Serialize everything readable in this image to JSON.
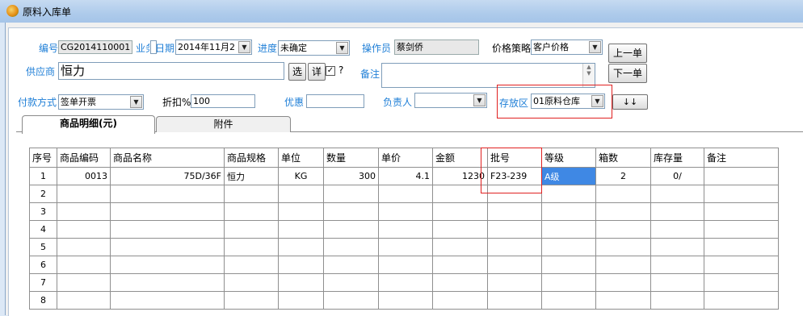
{
  "window": {
    "title": "原料入库单"
  },
  "header": {
    "code_label": "编号",
    "code_value": "CG2014110001",
    "biz_label_partial": "业务",
    "date_label_partial": "日期",
    "date_value": "2014年11月2",
    "progress_label": "进度",
    "progress_value": "未确定",
    "operator_label": "操作员",
    "operator_value": "蔡剑侨",
    "price_policy_label": "价格策略",
    "price_policy_value": "客户价格",
    "prev_button": "上一单",
    "next_button": "下一单",
    "supplier_label": "供应商",
    "supplier_value": "恒力",
    "select_button": "选",
    "detail_button": "详",
    "question": "?",
    "remark_label": "备注",
    "remark_value": "",
    "payment_label": "付款方式",
    "payment_value": "签单开票",
    "discount_label": "折扣%",
    "discount_value": "100",
    "preferential_label": "优惠",
    "preferential_value": "",
    "manager_label": "负责人",
    "manager_value": "",
    "storage_label": "存放区",
    "storage_value": "01原料仓库",
    "arrows_button": "↓↓"
  },
  "tabs": [
    {
      "label": "商品明细(元)",
      "active": true
    },
    {
      "label": "附件",
      "active": false
    }
  ],
  "table": {
    "columns": [
      "序号",
      "商品编码",
      "商品名称",
      "商品规格",
      "单位",
      "数量",
      "单价",
      "金额",
      "批号",
      "等级",
      "箱数",
      "库存量",
      "备注"
    ],
    "rows": [
      [
        "1",
        "0013",
        "75D/36F",
        "恒力",
        "KG",
        "300",
        "4.1",
        "1230",
        "F23-239",
        "A级",
        "2",
        "0/",
        ""
      ],
      [
        "2",
        "",
        "",
        "",
        "",
        "",
        "",
        "",
        "",
        "",
        "",
        "",
        ""
      ],
      [
        "3",
        "",
        "",
        "",
        "",
        "",
        "",
        "",
        "",
        "",
        "",
        "",
        ""
      ],
      [
        "4",
        "",
        "",
        "",
        "",
        "",
        "",
        "",
        "",
        "",
        "",
        "",
        ""
      ],
      [
        "5",
        "",
        "",
        "",
        "",
        "",
        "",
        "",
        "",
        "",
        "",
        "",
        ""
      ],
      [
        "6",
        "",
        "",
        "",
        "",
        "",
        "",
        "",
        "",
        "",
        "",
        "",
        ""
      ],
      [
        "7",
        "",
        "",
        "",
        "",
        "",
        "",
        "",
        "",
        "",
        "",
        "",
        ""
      ],
      [
        "8",
        "",
        "",
        "",
        "",
        "",
        "",
        "",
        "",
        "",
        "",
        "",
        ""
      ]
    ]
  }
}
